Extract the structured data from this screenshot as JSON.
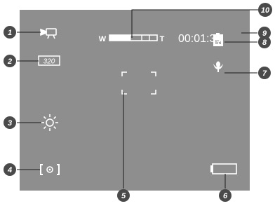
{
  "colors": {
    "screen": "#8e8e8e",
    "icon": "#ffffff",
    "callout_fill": "#4a4a4a",
    "leader": "#1a1a1a"
  },
  "screen": {
    "zoom_wide_label": "W",
    "zoom_tele_label": "T",
    "recording_time": "00:01:30",
    "resolution_label": "320",
    "memory_label": "IN"
  },
  "icons": {
    "mode": "video-camera-icon",
    "resolution": "resolution-320-icon",
    "white_balance": "sun-icon",
    "metering": "spot-metering-icon",
    "focus": "focus-frame-icon",
    "battery": "battery-icon",
    "macro": "macro-flower-icon",
    "memory": "internal-memory-icon",
    "time": "recording-time",
    "zoom": "zoom-bar-icon"
  },
  "zoom_level": 0.45,
  "callouts": [
    "1",
    "2",
    "3",
    "4",
    "5",
    "6",
    "7",
    "8",
    "9",
    "10"
  ]
}
